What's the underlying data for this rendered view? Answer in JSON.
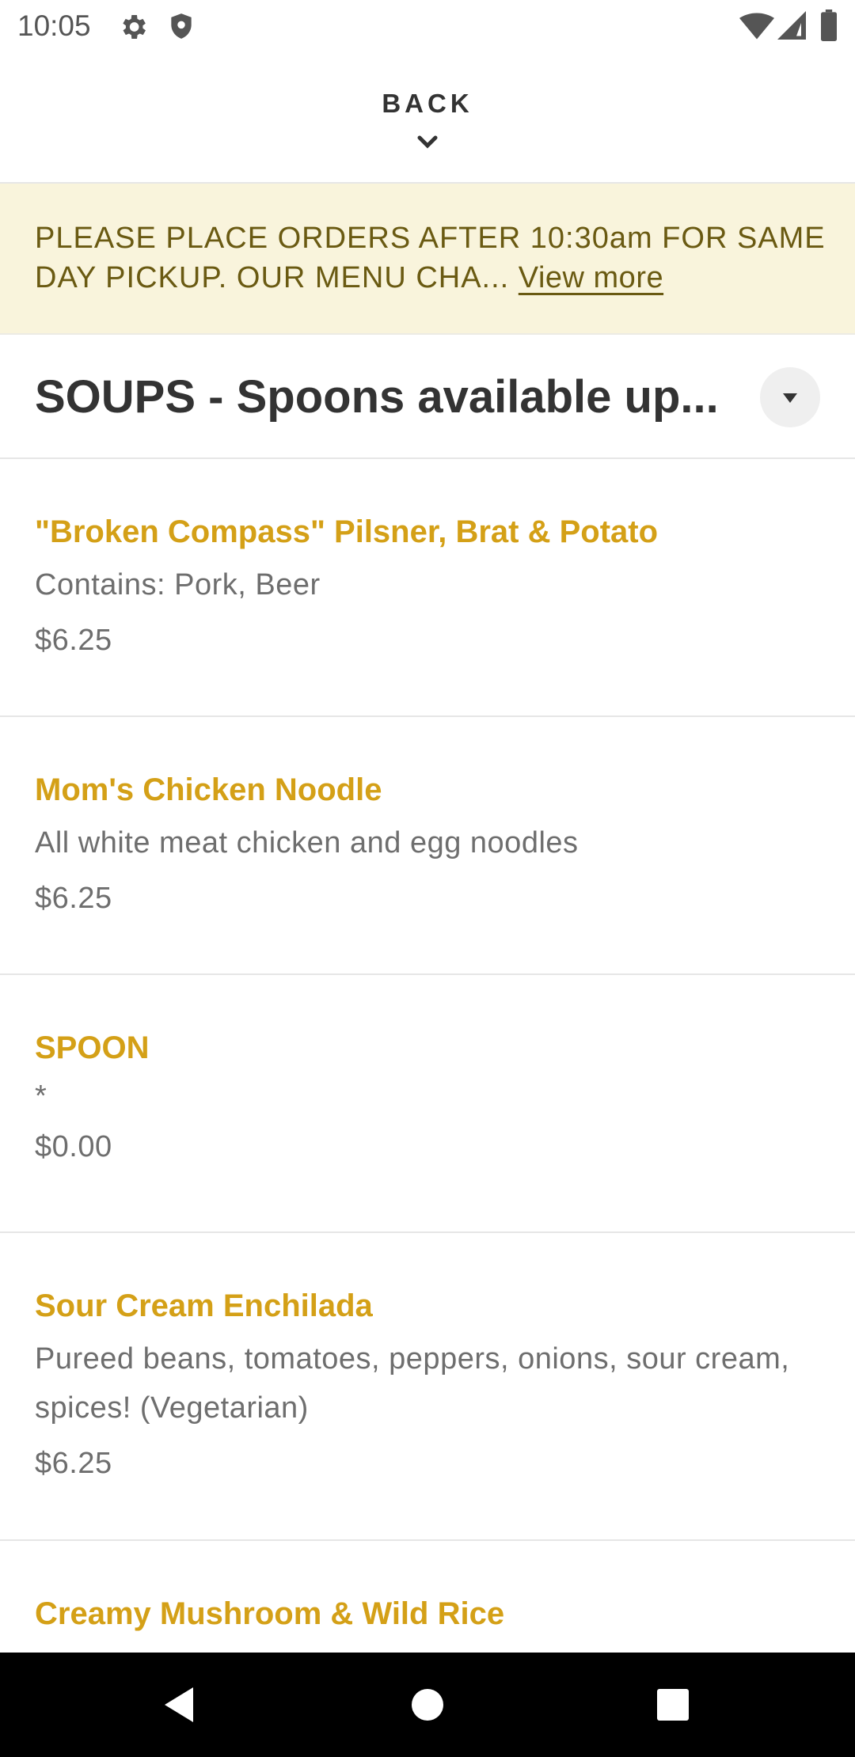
{
  "status_bar": {
    "time": "10:05",
    "icons": [
      "gear-icon",
      "shield-icon",
      "wifi-icon",
      "signal-icon",
      "battery-icon"
    ]
  },
  "back_bar": {
    "label": "BACK",
    "icon": "chevron-down-icon"
  },
  "notice": {
    "text": "PLEASE PLACE ORDERS AFTER 10:30am FOR SAME DAY PICKUP. OUR MENU CHA...",
    "link_label": "View more",
    "background": "#f9f4dc"
  },
  "category": {
    "title": "SOUPS - Spoons available up...",
    "toggle_icon": "dropdown-caret-icon"
  },
  "menu_items": [
    {
      "name": "\"Broken Compass\" Pilsner, Brat & Potato",
      "description": "Contains: Pork, Beer",
      "price": "$6.25"
    },
    {
      "name": "Mom's Chicken Noodle",
      "description": "All white meat chicken and egg noodles",
      "price": "$6.25"
    },
    {
      "name": "SPOON",
      "description": "*",
      "price": "$0.00"
    },
    {
      "name": "Sour Cream Enchilada",
      "description": "Pureed beans, tomatoes, peppers, onions, sour cream, spices! (Vegetarian)",
      "price": "$6.25"
    },
    {
      "name": "Creamy Mushroom & Wild Rice",
      "description": "",
      "price": ""
    }
  ],
  "nav_bar": {
    "buttons": [
      "back-triangle-icon",
      "home-circle-icon",
      "recents-square-icon"
    ]
  },
  "colors": {
    "accent": "#d4a017",
    "notice_text": "#6a5a12",
    "body_text": "#333333",
    "secondary_text": "#6e6e6e"
  }
}
